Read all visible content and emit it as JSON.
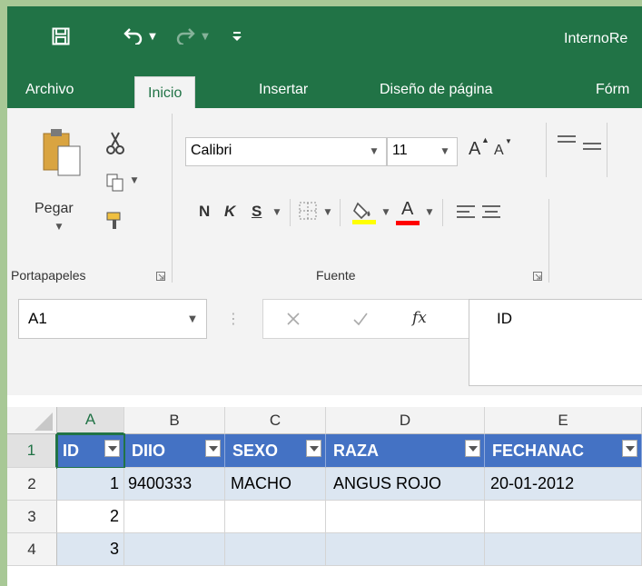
{
  "titlebar": {
    "title": "InternoRe",
    "icons": [
      "save-icon",
      "undo-icon",
      "undo-dropdown-icon",
      "redo-icon",
      "redo-dropdown-icon",
      "customize-qat-icon"
    ]
  },
  "tabs": [
    {
      "label": "Archivo"
    },
    {
      "label": "Inicio",
      "active": true
    },
    {
      "label": "Insertar"
    },
    {
      "label": "Diseño de página"
    },
    {
      "label": "Fórm"
    }
  ],
  "ribbon": {
    "clipboard": {
      "paste_label": "Pegar",
      "group_label": "Portapapeles"
    },
    "font": {
      "font_name": "Calibri",
      "font_size": "11",
      "bold_label": "N",
      "italic_label": "K",
      "underline_label": "S",
      "grow_label": "A",
      "shrink_label": "A",
      "font_color_label": "A",
      "group_label": "Fuente",
      "highlight_color": "#ffff00",
      "font_color": "#ff0000"
    }
  },
  "formula_bar": {
    "name_box": "A1",
    "fx_label": "fx",
    "content": "ID"
  },
  "sheet": {
    "columns": [
      "A",
      "B",
      "C",
      "D",
      "E"
    ],
    "rows": [
      "1",
      "2",
      "3",
      "4"
    ],
    "headers": [
      "ID",
      "DIIO",
      "SEXO",
      "RAZA",
      "FECHANAC"
    ],
    "data": [
      [
        "1",
        "9400333",
        "MACHO",
        "ANGUS ROJO",
        "20-01-2012"
      ],
      [
        "2",
        "",
        "",
        "",
        ""
      ],
      [
        "3",
        "",
        "",
        "",
        ""
      ]
    ],
    "header_fill": "#4472c4",
    "band_fill": "#dce6f1",
    "accent": "#217346"
  }
}
